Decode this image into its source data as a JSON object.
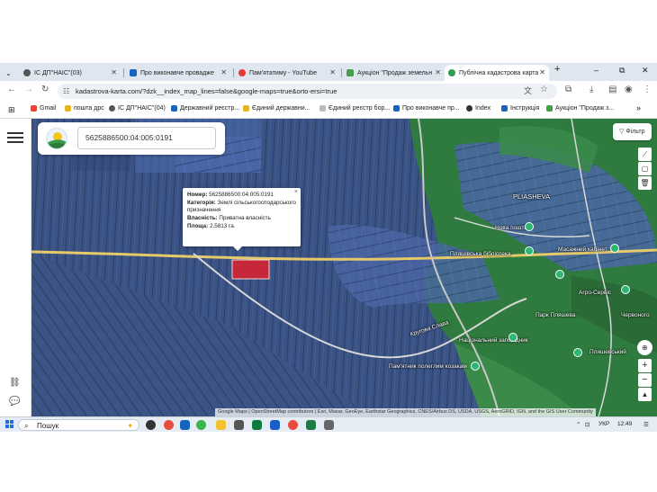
{
  "browser": {
    "tabs": [
      {
        "label": "ІС ДП\"НАІС\"(03)",
        "active": false
      },
      {
        "label": "Про виконавче провадже",
        "active": false
      },
      {
        "label": "Пам'ятатиму - YouTube",
        "active": false
      },
      {
        "label": "Аукціон \"Продаж земельн",
        "active": false
      },
      {
        "label": "Публічна кадастрова карта",
        "active": true
      }
    ],
    "new_tab_label": "+",
    "window_controls": {
      "minimize": "–",
      "maximize": "⧉",
      "close": "✕"
    },
    "url": "kadastrova-karta.com/?dzk__index_map_lines=false&google-maps=true&orto-ersi=true",
    "bookmarks": [
      {
        "label": "Gmail",
        "color": "#ea4335"
      },
      {
        "label": "пошта дрс",
        "color": "#e6b422"
      },
      {
        "label": "ІС ДП\"НАІС\"(04)",
        "color": "#555555"
      },
      {
        "label": "Державний реєстр...",
        "color": "#1565c0"
      },
      {
        "label": "Єдиний державни...",
        "color": "#e6b422"
      },
      {
        "label": "Єдиний реєстр бор...",
        "color": "#888888"
      },
      {
        "label": "Про виконавче пр...",
        "color": "#1565c0"
      },
      {
        "label": "Index",
        "color": "#333333"
      },
      {
        "label": "Інструкція",
        "color": "#1565c0"
      },
      {
        "label": "Аукціон \"Продаж з...",
        "color": "#43a047"
      }
    ],
    "bookmarks_more": "»"
  },
  "map_app": {
    "search_value": "5625886500:04:005:0191",
    "filter_label": "Фільтр",
    "popup": {
      "number_label": "Номер:",
      "number_value": "5625886500:04:005:0191",
      "category_label": "Категорія:",
      "category_value": "Землі сільськогосподарського призначення",
      "ownership_label": "Власність:",
      "ownership_value": "Приватна власність",
      "area_label": "Площа:",
      "area_value": "2.5813 га.",
      "close": "×"
    },
    "attribution": "Google Maps | OpenStreetMap contributors | Esri, Maxar, GeoEye, Earthstar Geographics, CNES/Airbus DS, USDA, USGS, AeroGRID, IGN, and the GIS User Community",
    "place_labels": [
      "PLIASHEVA",
      "Нова пошта",
      "Пляшівська бібліотека",
      "Масажний кабінет",
      "Агро-Сервіс",
      "Червоного",
      "Пляшевський",
      "Парк Пляшева",
      "Кругова Слава",
      "Національний заповідник",
      "Пам'ятник полеглим козакам"
    ],
    "zoom_in": "+",
    "zoom_out": "−"
  },
  "taskbar": {
    "search_text": "Пошук",
    "language": "УКР",
    "time": "12:49"
  },
  "colors": {
    "selected_parcel": "#c62839",
    "poi_green": "#2bb673",
    "tab_active": "#ffffff",
    "tab_bar": "#dfe6ef"
  }
}
